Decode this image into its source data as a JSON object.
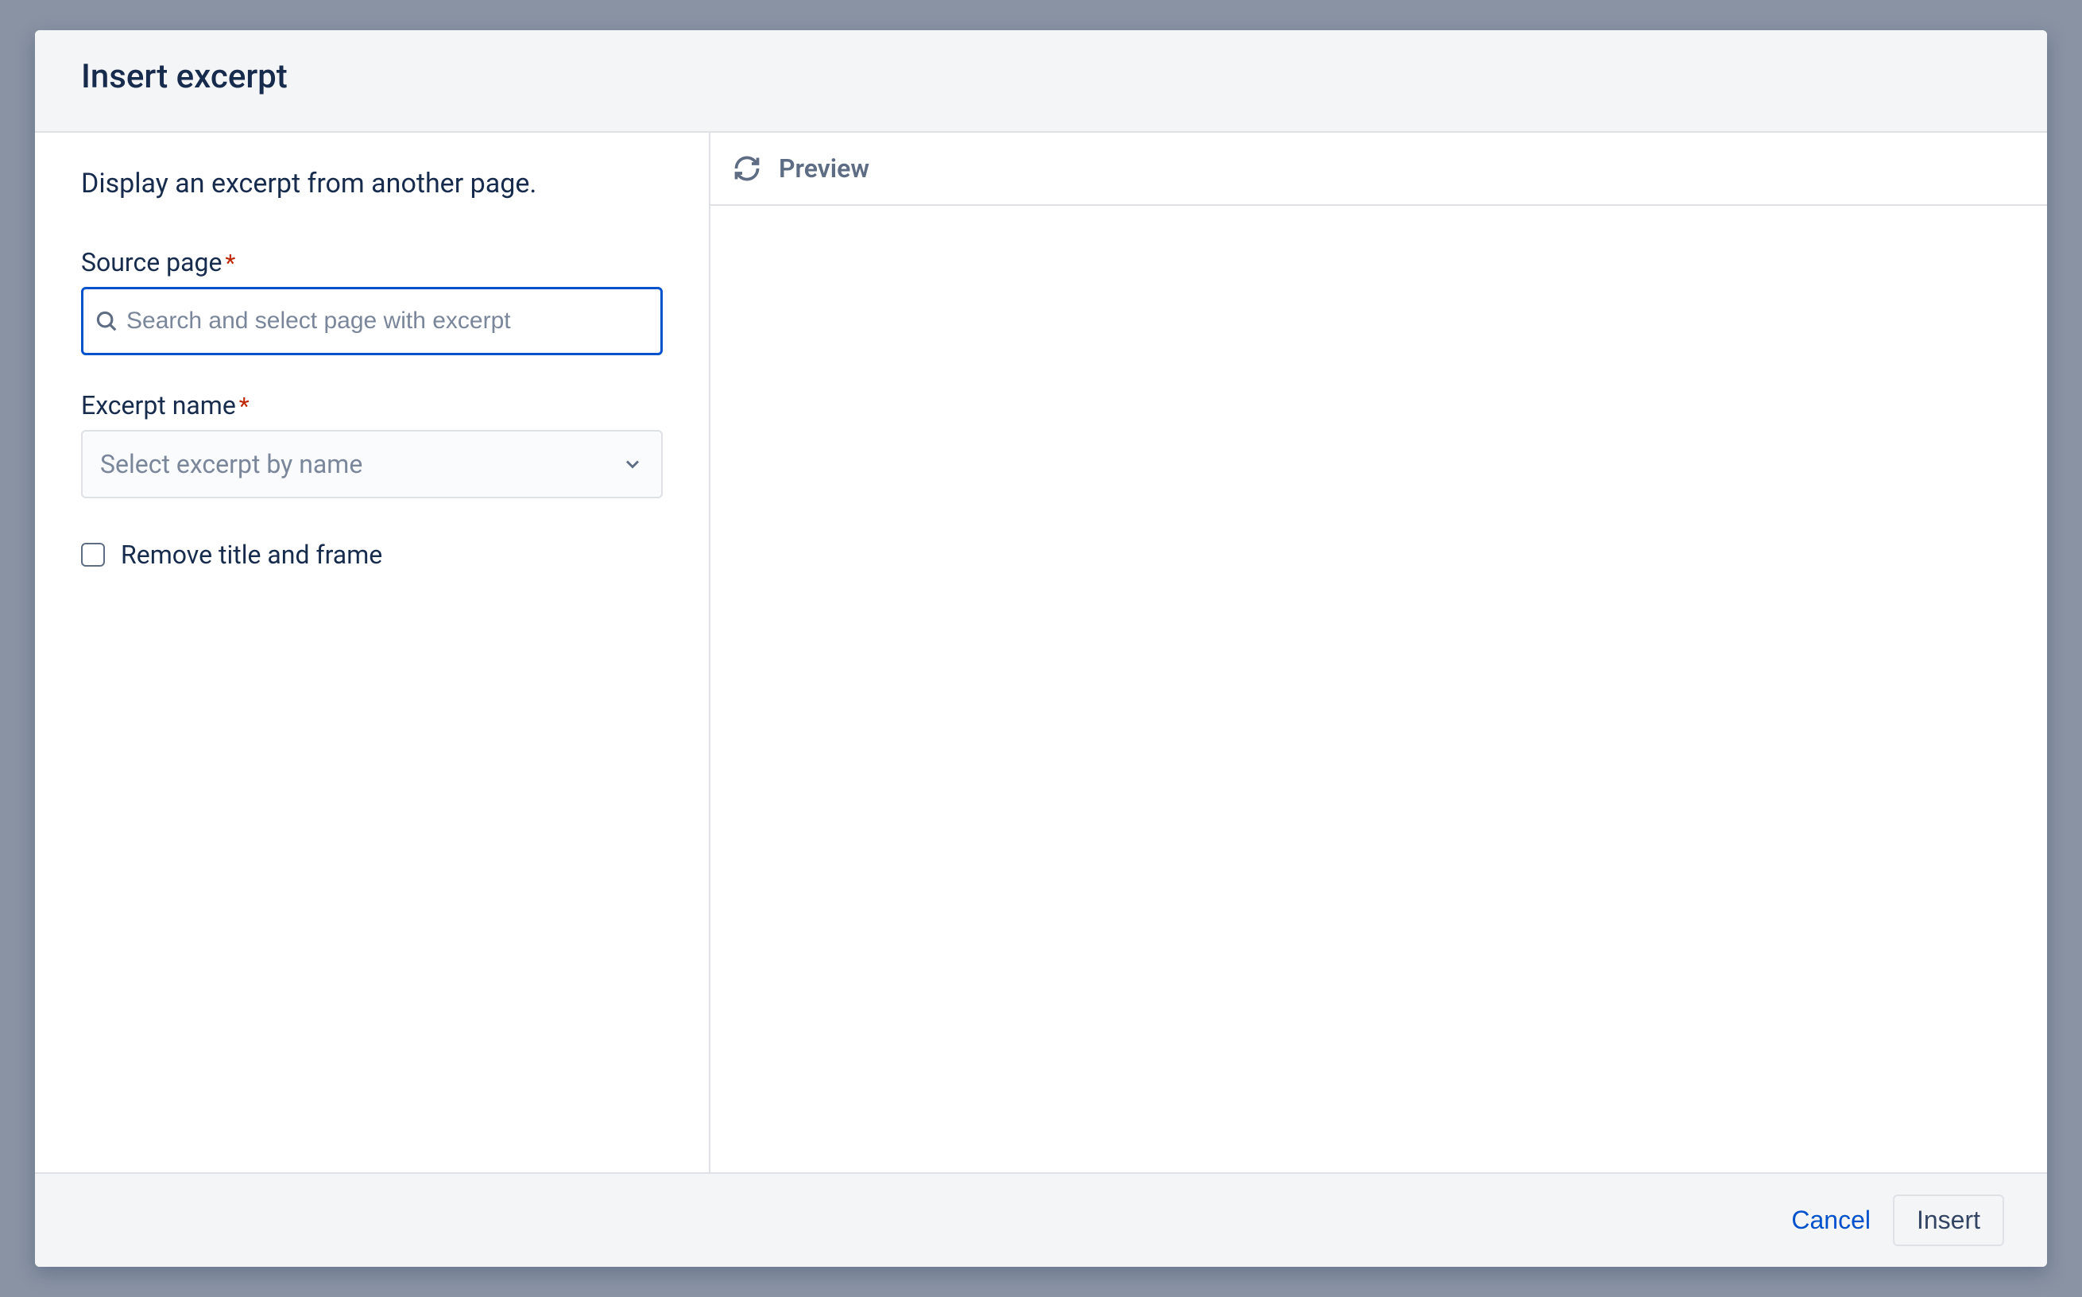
{
  "dialog": {
    "title": "Insert excerpt",
    "description": "Display an excerpt from another page."
  },
  "form": {
    "sourcePage": {
      "label": "Source page",
      "placeholder": "Search and select page with excerpt"
    },
    "excerptName": {
      "label": "Excerpt name",
      "placeholder": "Select excerpt by name"
    },
    "removeFrame": {
      "label": "Remove title and frame",
      "checked": false
    }
  },
  "preview": {
    "label": "Preview"
  },
  "footer": {
    "cancel": "Cancel",
    "insert": "Insert"
  }
}
